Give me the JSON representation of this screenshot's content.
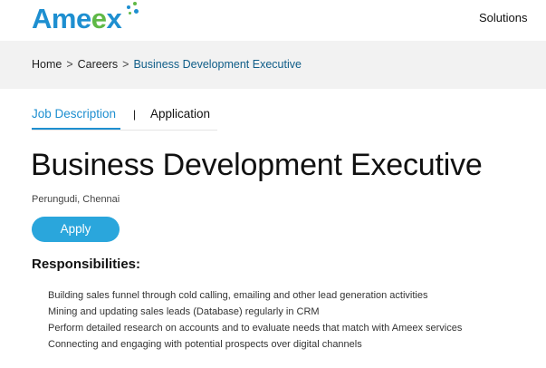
{
  "header": {
    "logo_text": "Ameex",
    "nav": {
      "solutions_label": "Solutions"
    }
  },
  "breadcrumb": {
    "items": [
      "Home",
      "Careers",
      "Business Development Executive"
    ],
    "separator": ">"
  },
  "tabs": {
    "job_description": "Job Description",
    "divider": "|",
    "application": "Application",
    "active": "job_description"
  },
  "job": {
    "title": "Business Development Executive",
    "location": "Perungudi, Chennai",
    "apply_label": "Apply"
  },
  "responsibilities": {
    "heading": "Responsibilities:",
    "items": [
      "Building sales funnel through cold calling, emailing and other lead generation activities",
      "Mining and updating sales leads (Database) regularly in CRM",
      "Perform detailed research on accounts and to evaluate needs that match with Ameex services",
      "Connecting and engaging with potential prospects over digital channels"
    ]
  },
  "colors": {
    "brand_blue": "#1e8fd0",
    "brand_green": "#5fb846",
    "button_blue": "#2aa6dc",
    "breadcrumb_current": "#0f5d88",
    "crumb_bg": "#f2f2f2"
  }
}
